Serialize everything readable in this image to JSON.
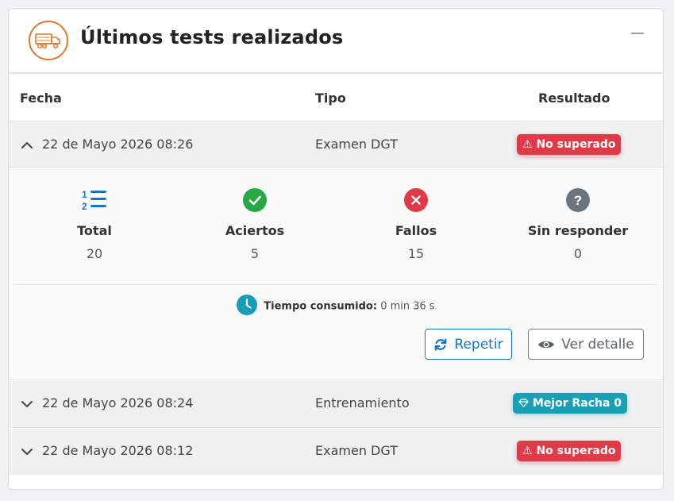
{
  "card": {
    "title": "Últimos tests realizados",
    "icon": "truck-icon",
    "accent": "#e0782a"
  },
  "table": {
    "headers": {
      "date": "Fecha",
      "type": "Tipo",
      "result": "Resultado"
    },
    "rows": [
      {
        "date": "22 de Mayo 2026 08:26",
        "type": "Examen DGT",
        "result": "No superado",
        "result_icon": "warning-icon",
        "expanded": true
      },
      {
        "date": "22 de Mayo 2026 08:24",
        "type": "Entrenamiento",
        "result": "Mejor Racha 0",
        "result_icon": "diamond-icon",
        "expanded": false
      },
      {
        "date": "22 de Mayo 2026 08:12",
        "type": "Examen DGT",
        "result": "No superado",
        "result_icon": "warning-icon",
        "expanded": false
      }
    ]
  },
  "detail": {
    "stats": [
      {
        "label": "Total",
        "value": "20",
        "icon": "numbered-list-icon",
        "color": "#1677c8"
      },
      {
        "label": "Aciertos",
        "value": "5",
        "icon": "check-circle-icon",
        "color": "#28a745"
      },
      {
        "label": "Fallos",
        "value": "15",
        "icon": "x-circle-icon",
        "color": "#e03a48"
      },
      {
        "label": "Sin responder",
        "value": "0",
        "icon": "question-circle-icon",
        "color": "#6c757d"
      }
    ],
    "time_label": "Tiempo consumido:",
    "time_value": "0 min 36 s",
    "repeat_label": "Repetir",
    "detail_label": "Ver detalle"
  },
  "colors": {
    "danger": "#e03a48",
    "info": "#1aa0b4",
    "primary": "#1677c8"
  }
}
